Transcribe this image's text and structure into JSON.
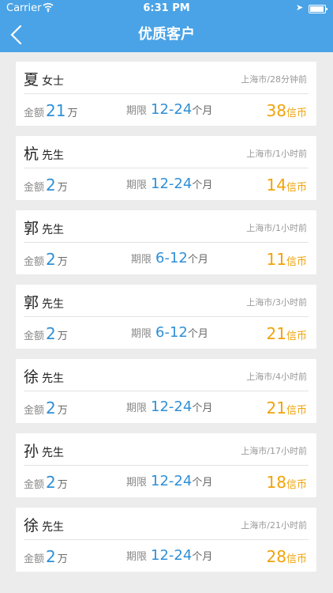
{
  "status_bar": {
    "carrier": "Carrier",
    "time": "6:31 PM"
  },
  "nav": {
    "title": "优质客户"
  },
  "labels": {
    "amount": "金额",
    "amount_unit": "万",
    "term": "期限",
    "term_unit": "个月",
    "coins_unit": "信币"
  },
  "customers": [
    {
      "surname": "夏",
      "title": "女士",
      "meta": "上海市/28分钟前",
      "amount": "21",
      "term": "12-24",
      "coins": "38"
    },
    {
      "surname": "杭",
      "title": "先生",
      "meta": "上海市/1小时前",
      "amount": "2",
      "term": "12-24",
      "coins": "14"
    },
    {
      "surname": "郭",
      "title": "先生",
      "meta": "上海市/1小时前",
      "amount": "2",
      "term": "6-12",
      "coins": "11"
    },
    {
      "surname": "郭",
      "title": "先生",
      "meta": "上海市/3小时前",
      "amount": "2",
      "term": "6-12",
      "coins": "21"
    },
    {
      "surname": "徐",
      "title": "先生",
      "meta": "上海市/4小时前",
      "amount": "2",
      "term": "12-24",
      "coins": "21"
    },
    {
      "surname": "孙",
      "title": "先生",
      "meta": "上海市/17小时前",
      "amount": "2",
      "term": "12-24",
      "coins": "18"
    },
    {
      "surname": "徐",
      "title": "先生",
      "meta": "上海市/21小时前",
      "amount": "2",
      "term": "12-24",
      "coins": "28"
    }
  ]
}
